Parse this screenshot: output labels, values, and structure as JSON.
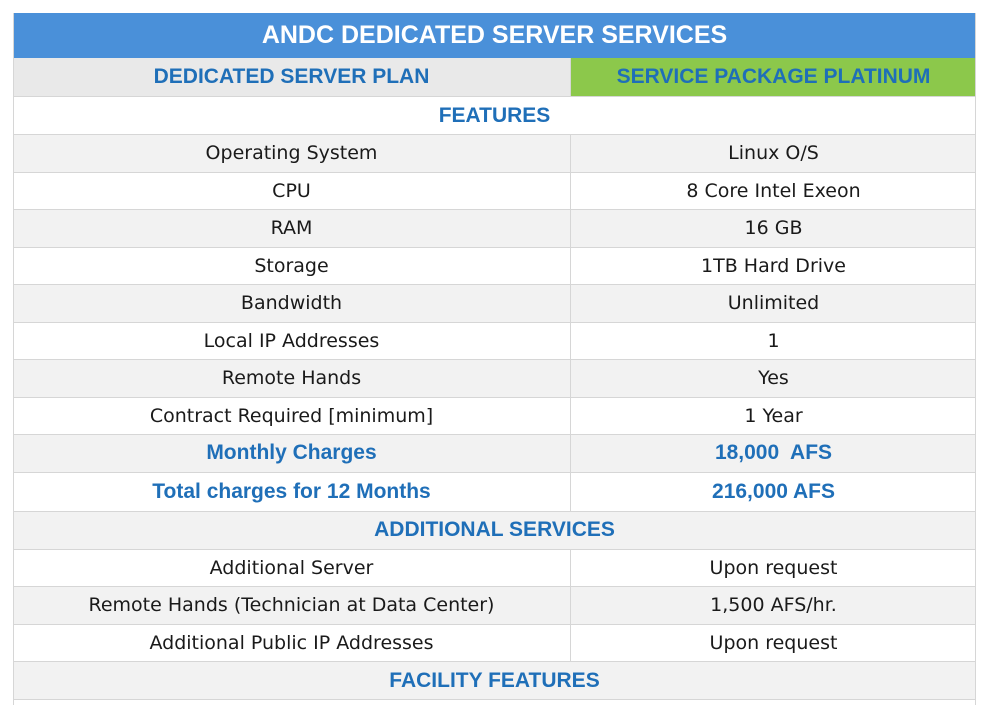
{
  "title": "ANDC DEDICATED SERVER SERVICES",
  "header": {
    "plan_label": "DEDICATED SERVER PLAN",
    "package_label": "SERVICE PACKAGE PLATINUM"
  },
  "sections": {
    "features": "FEATURES",
    "additional_services": "ADDITIONAL SERVICES",
    "facility_features": "FACILITY FEATURES"
  },
  "features": [
    {
      "label": "Operating System",
      "value": "Linux O/S"
    },
    {
      "label": "CPU",
      "value": "8 Core Intel Exeon"
    },
    {
      "label": "RAM",
      "value": "16 GB"
    },
    {
      "label": "Storage",
      "value": "1TB Hard Drive"
    },
    {
      "label": "Bandwidth",
      "value": "Unlimited"
    },
    {
      "label": "Local IP Addresses",
      "value": "1"
    },
    {
      "label": "Remote Hands",
      "value": "Yes"
    },
    {
      "label": "Contract Required [minimum]",
      "value": "1 Year"
    }
  ],
  "charges": [
    {
      "label": "Monthly Charges",
      "value": "18,000  AFS"
    },
    {
      "label": "Total charges for 12 Months",
      "value": "216,000 AFS"
    }
  ],
  "additional": [
    {
      "label": "Additional Server",
      "value": "Upon request"
    },
    {
      "label": "Remote Hands (Technician at Data Center)",
      "value": "1,500 AFS/hr."
    },
    {
      "label": "Additional Public IP Addresses",
      "value": "Upon request"
    }
  ],
  "colors": {
    "title_bg": "#4a90d9",
    "accent_text": "#1f6fb8",
    "package_bg": "#8cc84b",
    "alt_row_bg": "#f2f2f2"
  }
}
